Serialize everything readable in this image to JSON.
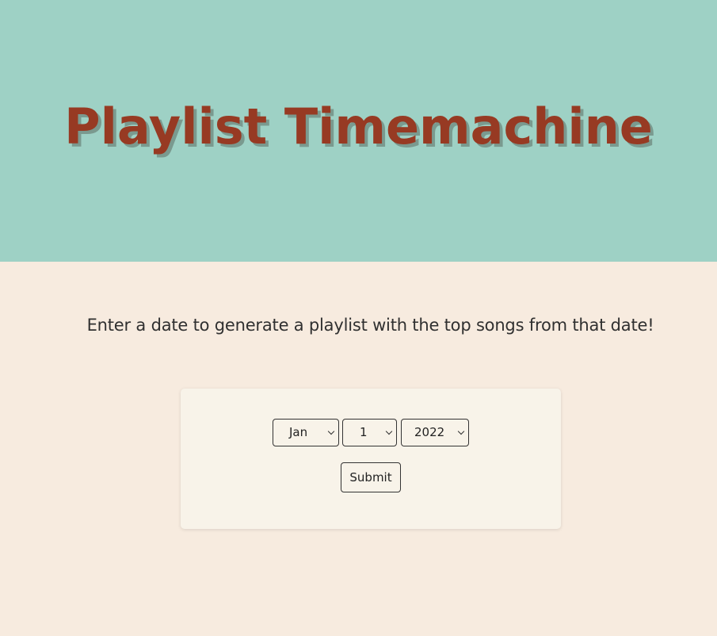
{
  "header": {
    "title": "Playlist Timemachine"
  },
  "main": {
    "intro_text": "Enter a date to generate a playlist with the top songs from that date!"
  },
  "form": {
    "month_value": "Jan",
    "day_value": "1",
    "year_value": "2022",
    "submit_label": "Submit"
  },
  "colors": {
    "header_bg": "#9ed1c5",
    "title": "#973a23",
    "page_bg": "#f7ebdf",
    "card_bg": "#f8f3e9"
  }
}
